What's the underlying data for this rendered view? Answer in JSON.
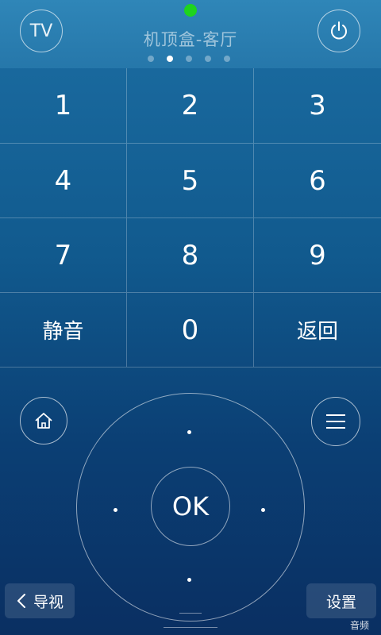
{
  "header": {
    "tv_label": "TV",
    "title": "机顶盒-客厅",
    "page_count": 5,
    "active_page": 2,
    "status_led_color": "#1ed41e",
    "power_icon": "power-icon"
  },
  "keypad": {
    "keys": [
      "1",
      "2",
      "3",
      "4",
      "5",
      "6",
      "7",
      "8",
      "9",
      "静音",
      "0",
      "返回"
    ]
  },
  "nav": {
    "home_icon": "home-icon",
    "menu_icon": "menu-icon",
    "ok_label": "OK"
  },
  "bottom": {
    "guide_label": "导视",
    "settings_label": "设置",
    "audio_label": "音频"
  },
  "colors": {
    "background_top": "#1c6ea3",
    "background_bottom": "#0a2f62",
    "led": "#1ed41e"
  }
}
